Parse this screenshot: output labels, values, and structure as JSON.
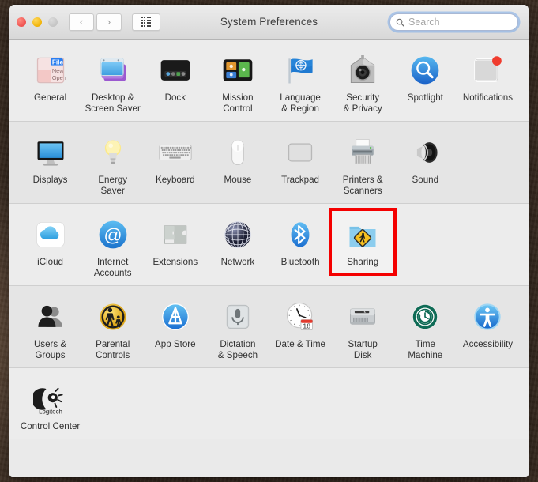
{
  "window": {
    "title": "System Preferences",
    "traffic_lights": [
      {
        "name": "close",
        "color": "#ef5350"
      },
      {
        "name": "minimize",
        "color": "#efb000"
      },
      {
        "name": "zoom",
        "color": "#c3c3c3"
      }
    ],
    "toolbar": {
      "back_label": "‹",
      "forward_label": "›",
      "show_all_label": "Show All"
    },
    "search": {
      "value": "",
      "placeholder": "Search",
      "clear_label": "✕"
    }
  },
  "rows": [
    {
      "shade": "lite",
      "panes": [
        {
          "id": "general",
          "label": "General",
          "icon": "general-icon"
        },
        {
          "id": "desktop",
          "label": "Desktop &\nScreen Saver",
          "icon": "desktop-screensaver-icon"
        },
        {
          "id": "dock",
          "label": "Dock",
          "icon": "dock-icon"
        },
        {
          "id": "mission",
          "label": "Mission\nControl",
          "icon": "mission-control-icon"
        },
        {
          "id": "language",
          "label": "Language\n& Region",
          "icon": "language-region-icon"
        },
        {
          "id": "security",
          "label": "Security\n& Privacy",
          "icon": "security-privacy-icon"
        },
        {
          "id": "spotlight",
          "label": "Spotlight",
          "icon": "spotlight-icon"
        },
        {
          "id": "notifications",
          "label": "Notifications",
          "icon": "notifications-icon"
        }
      ]
    },
    {
      "shade": "alt",
      "panes": [
        {
          "id": "displays",
          "label": "Displays",
          "icon": "displays-icon"
        },
        {
          "id": "energy",
          "label": "Energy\nSaver",
          "icon": "energy-saver-icon"
        },
        {
          "id": "keyboard",
          "label": "Keyboard",
          "icon": "keyboard-icon"
        },
        {
          "id": "mouse",
          "label": "Mouse",
          "icon": "mouse-icon"
        },
        {
          "id": "trackpad",
          "label": "Trackpad",
          "icon": "trackpad-icon"
        },
        {
          "id": "printers",
          "label": "Printers &\nScanners",
          "icon": "printers-scanners-icon"
        },
        {
          "id": "sound",
          "label": "Sound",
          "icon": "sound-icon"
        }
      ]
    },
    {
      "shade": "lite",
      "panes": [
        {
          "id": "icloud",
          "label": "iCloud",
          "icon": "icloud-icon"
        },
        {
          "id": "internet",
          "label": "Internet\nAccounts",
          "icon": "internet-accounts-icon"
        },
        {
          "id": "extensions",
          "label": "Extensions",
          "icon": "extensions-icon"
        },
        {
          "id": "network",
          "label": "Network",
          "icon": "network-icon"
        },
        {
          "id": "bluetooth",
          "label": "Bluetooth",
          "icon": "bluetooth-icon"
        },
        {
          "id": "sharing",
          "label": "Sharing",
          "icon": "sharing-icon",
          "highlighted": true,
          "highlight_color": "#f40000"
        }
      ]
    },
    {
      "shade": "alt",
      "panes": [
        {
          "id": "users",
          "label": "Users &\nGroups",
          "icon": "users-groups-icon"
        },
        {
          "id": "parental",
          "label": "Parental\nControls",
          "icon": "parental-controls-icon"
        },
        {
          "id": "appstore",
          "label": "App Store",
          "icon": "app-store-icon"
        },
        {
          "id": "dictation",
          "label": "Dictation\n& Speech",
          "icon": "dictation-speech-icon"
        },
        {
          "id": "datetime",
          "label": "Date & Time",
          "icon": "date-time-icon",
          "badge": "18"
        },
        {
          "id": "startupdisk",
          "label": "Startup\nDisk",
          "icon": "startup-disk-icon"
        },
        {
          "id": "timemachine",
          "label": "Time\nMachine",
          "icon": "time-machine-icon"
        },
        {
          "id": "accessibility",
          "label": "Accessibility",
          "icon": "accessibility-icon"
        }
      ]
    },
    {
      "shade": "lite",
      "panes": [
        {
          "id": "logitech",
          "label": "Control Center",
          "icon": "logitech-icon",
          "icon_text": "Logitech"
        }
      ]
    }
  ]
}
